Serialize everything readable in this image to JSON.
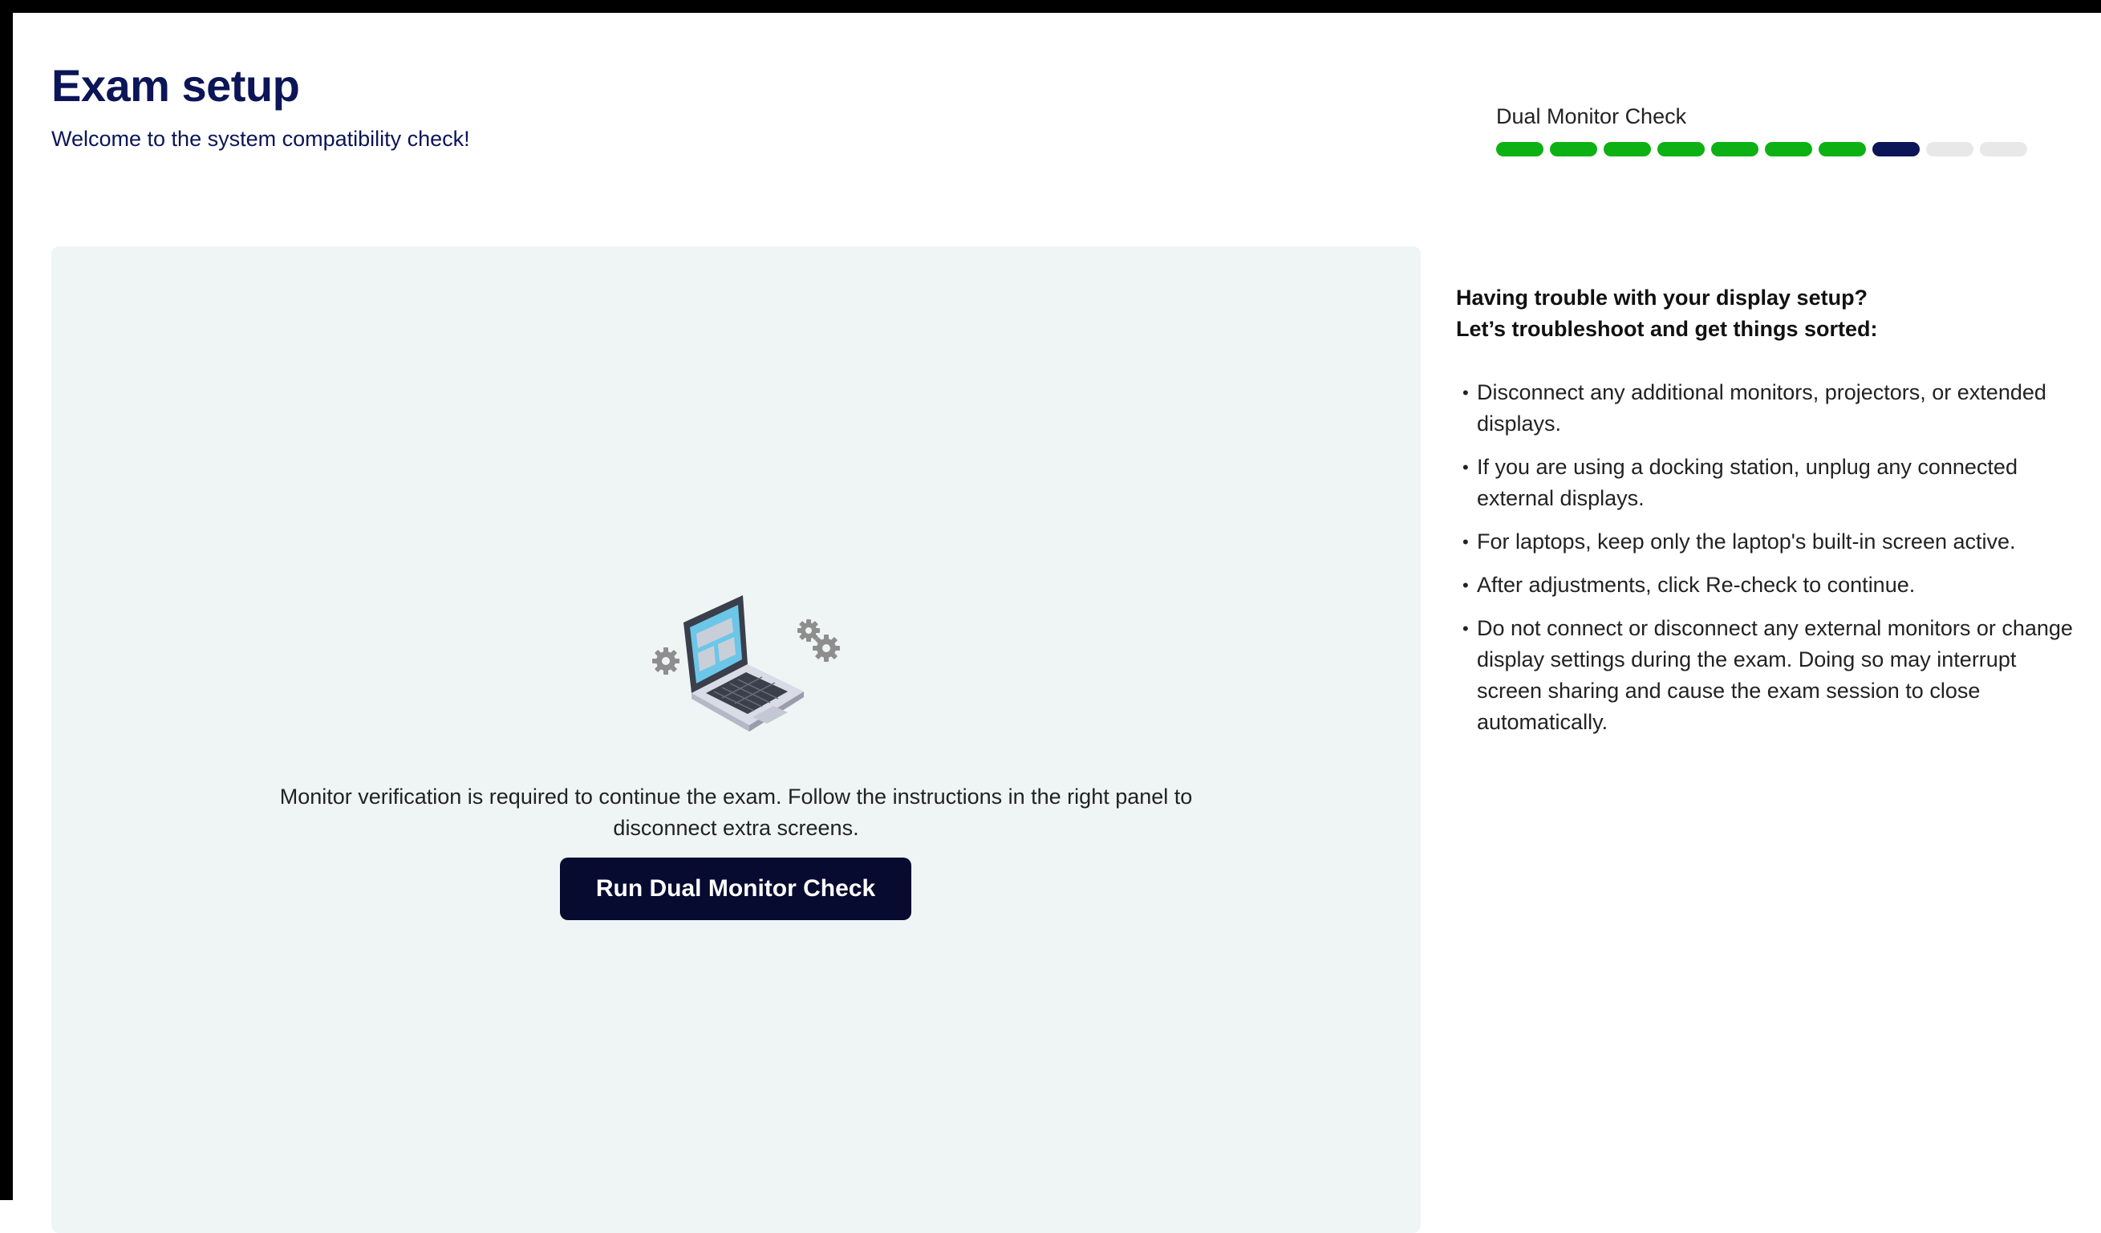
{
  "header": {
    "title": "Exam setup",
    "subtitle": "Welcome to the system compatibility check!"
  },
  "progress": {
    "label": "Dual Monitor Check",
    "total_steps": 10,
    "completed_steps": 7,
    "current_step": 8,
    "colors": {
      "done": "#0db114",
      "current": "#0c1557",
      "pending": "#e8e8e8"
    }
  },
  "main": {
    "illustration_icon": "laptop-gears-icon",
    "message": "Monitor verification is required to continue the exam. Follow the instructions in the right panel to disconnect extra screens.",
    "button_label": "Run Dual Monitor Check"
  },
  "help": {
    "heading_line1": "Having trouble with your display setup?",
    "heading_line2": "Let’s troubleshoot and get things sorted:",
    "tips": [
      "Disconnect any additional monitors, projectors, or extended displays.",
      "If you are using a docking station, unplug any connected external displays.",
      "For laptops, keep only the laptop's built-in screen active.",
      "After adjustments, click Re-check to continue.",
      "Do not connect or disconnect any external monitors or change display settings during the exam. Doing so may interrupt screen sharing and cause the exam session to close automatically."
    ]
  },
  "colors": {
    "title": "#0c1557",
    "button_bg": "#070b30",
    "panel_bg": "#eff5f5"
  }
}
